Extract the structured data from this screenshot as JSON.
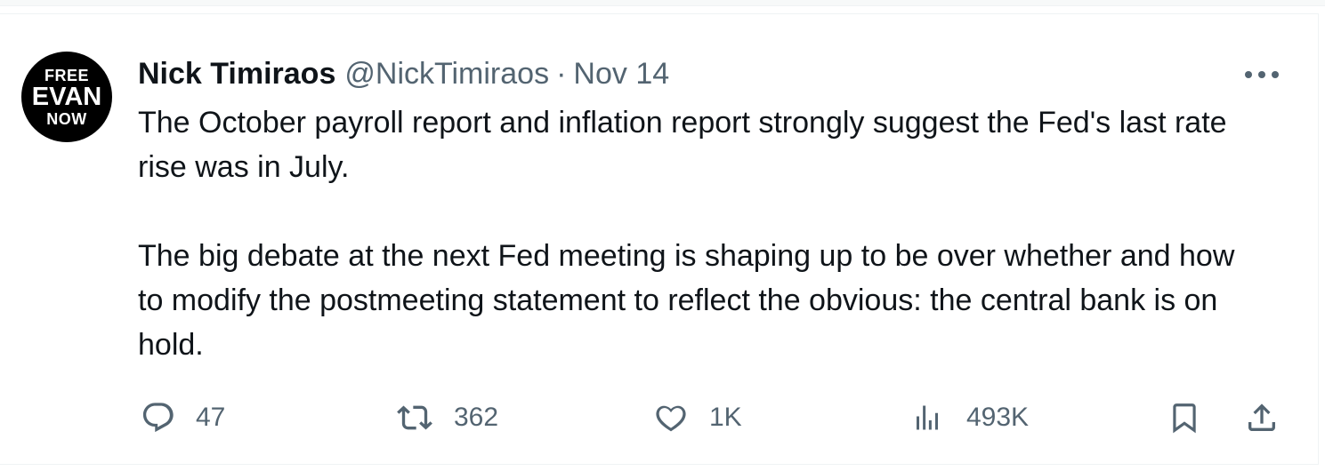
{
  "author": {
    "avatar_lines": [
      "FREE",
      "EVAN",
      "NOW"
    ],
    "name": "Nick Timiraos",
    "handle": "@NickTimiraos",
    "separator": "·",
    "date": "Nov 14"
  },
  "tweet": {
    "paragraphs": [
      "The October payroll report and inflation report strongly suggest the Fed's last rate rise was in July.",
      "The big debate at the next Fed meeting is shaping up to be over whether and how to modify the postmeeting statement to reflect the obvious: the central bank is on hold."
    ]
  },
  "actions": {
    "replies": "47",
    "reposts": "362",
    "likes": "1K",
    "views": "493K"
  },
  "icons": {
    "reply": "reply-icon",
    "repost": "repost-icon",
    "like": "heart-icon",
    "views": "views-icon",
    "bookmark": "bookmark-icon",
    "share": "share-icon",
    "more": "more-icon"
  },
  "colors": {
    "text": "#0f1419",
    "secondary": "#536471",
    "border": "#eff3f4"
  }
}
